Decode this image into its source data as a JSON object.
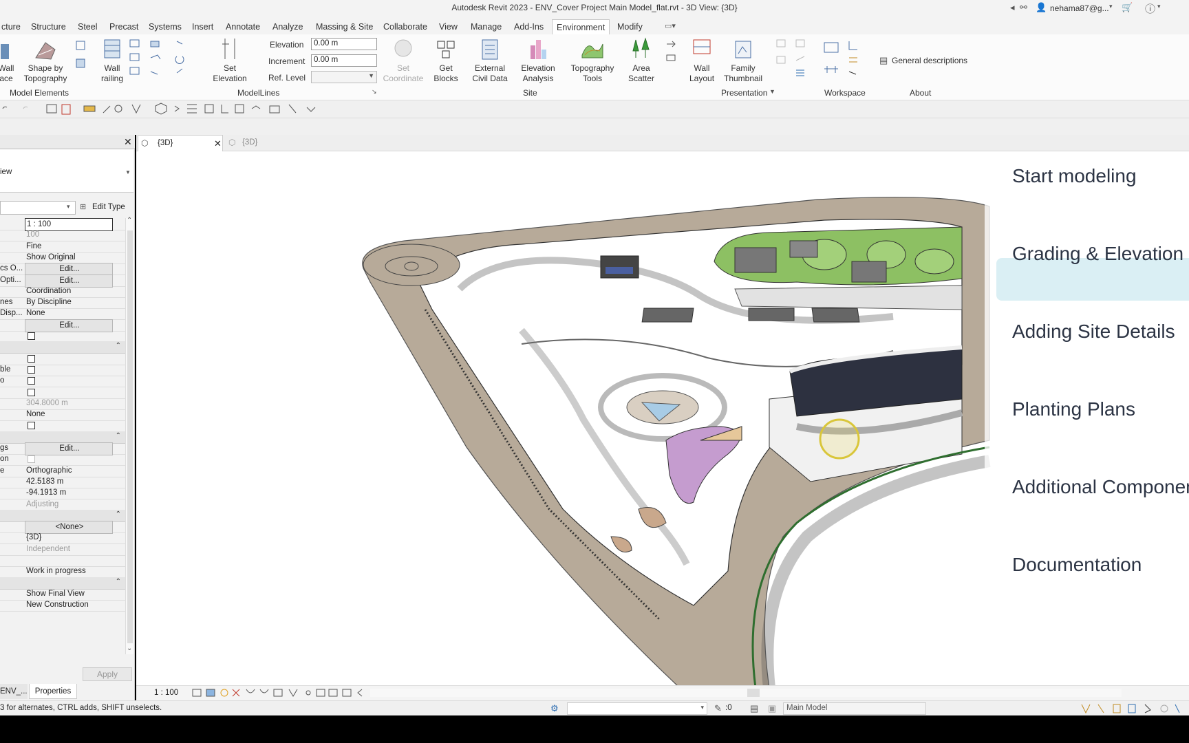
{
  "title": "Autodesk Revit 2023 - ENV_Cover Project Main Model_flat.rvt - 3D View: {3D}",
  "user": "nehama87@g...",
  "menu_tabs": [
    "cture",
    "Structure",
    "Steel",
    "Precast",
    "Systems",
    "Insert",
    "Annotate",
    "Analyze",
    "Massing & Site",
    "Collaborate",
    "View",
    "Manage",
    "Add-Ins",
    "Environment",
    "Modify"
  ],
  "ribbon": {
    "wall_face": "Wall\nace",
    "shape_by_topography": "Shape by\nTopography",
    "wall_railing": "Wall\nrailing",
    "model_elements": "Model Elements",
    "set_elevation": "Set\nElevation",
    "elevation_label": "Elevation",
    "elevation_value": "0.00 m",
    "increment_label": "Increment",
    "increment_value": "0.00 m",
    "ref_level_label": "Ref. Level",
    "modellines": "ModelLines",
    "set_coordinate": "Set\nCoordinate",
    "get_blocks": "Get\nBlocks",
    "external_civil_data": "External\nCivil Data",
    "elevation_analysis": "Elevation\nAnalysis",
    "topography_tools": "Topography\nTools",
    "area_scatter": "Area\nScatter",
    "site": "Site",
    "wall_layout": "Wall\nLayout",
    "family_thumbnail": "Family\nThumbnail",
    "presentation": "Presentation",
    "workspace": "Workspace",
    "general_descriptions": "General descriptions",
    "about": "About"
  },
  "properties": {
    "type_value": "iew",
    "edit_type": "Edit Type",
    "apply": "Apply",
    "bottom_tabs": [
      "ENV_...",
      "Properties"
    ],
    "rows": [
      {
        "k": "",
        "v": "1 : 100",
        "style": "box"
      },
      {
        "k": "",
        "v": "100",
        "style": "grey"
      },
      {
        "k": "",
        "v": "Fine",
        "style": ""
      },
      {
        "k": "",
        "v": "Show Original",
        "style": ""
      },
      {
        "k": "cs O...",
        "v": "Edit...",
        "style": "btn"
      },
      {
        "k": "Opti...",
        "v": "Edit...",
        "style": "btn"
      },
      {
        "k": "",
        "v": "Coordination",
        "style": ""
      },
      {
        "k": "nes",
        "v": "By Discipline",
        "style": ""
      },
      {
        "k": "Disp...",
        "v": "None",
        "style": ""
      },
      {
        "k": "",
        "v": "Edit...",
        "style": "btn"
      },
      {
        "k": "",
        "v": "",
        "style": "cb"
      },
      {
        "k": "",
        "v": "",
        "style": "sec"
      },
      {
        "k": "",
        "v": "",
        "style": "cb"
      },
      {
        "k": "ble",
        "v": "",
        "style": "cb"
      },
      {
        "k": "o",
        "v": "",
        "style": "cb"
      },
      {
        "k": "",
        "v": "",
        "style": "cb"
      },
      {
        "k": "",
        "v": "304.8000 m",
        "style": "grey"
      },
      {
        "k": "",
        "v": "None",
        "style": ""
      },
      {
        "k": "",
        "v": "",
        "style": "cb"
      },
      {
        "k": "",
        "v": "",
        "style": "sec"
      },
      {
        "k": "gs",
        "v": "Edit...",
        "style": "btn"
      },
      {
        "k": "on",
        "v": "",
        "style": "cbg"
      },
      {
        "k": "e",
        "v": "Orthographic",
        "style": ""
      },
      {
        "k": "",
        "v": "42.5183 m",
        "style": ""
      },
      {
        "k": "",
        "v": "-94.1913 m",
        "style": ""
      },
      {
        "k": "",
        "v": "Adjusting",
        "style": "grey"
      },
      {
        "k": "",
        "v": "",
        "style": "sec"
      },
      {
        "k": "",
        "v": "<None>",
        "style": "btn"
      },
      {
        "k": "",
        "v": "{3D}",
        "style": ""
      },
      {
        "k": "",
        "v": "Independent",
        "style": "grey"
      },
      {
        "k": "",
        "v": "",
        "style": ""
      },
      {
        "k": "",
        "v": "Work in progress",
        "style": ""
      },
      {
        "k": "",
        "v": "",
        "style": "sec"
      },
      {
        "k": "",
        "v": "Show Final View",
        "style": ""
      },
      {
        "k": "",
        "v": "New Construction",
        "style": ""
      }
    ]
  },
  "view_tabs": [
    "{3D}",
    "{3D}"
  ],
  "overlay_menu": [
    "Start modeling",
    "Grading & Elevation",
    "Adding Site Details",
    "Planting Plans",
    "Additional Components",
    "Documentation"
  ],
  "view_scale": "1 : 100",
  "status_text": "3 for alternates, CTRL adds, SHIFT unselects.",
  "status_zero": ":0",
  "model_name": "Main Model",
  "colors": {
    "accent": "#0696d7",
    "highlight": "#d6edf3",
    "terrain": "#b7aa99",
    "planting": "#8dc063"
  }
}
